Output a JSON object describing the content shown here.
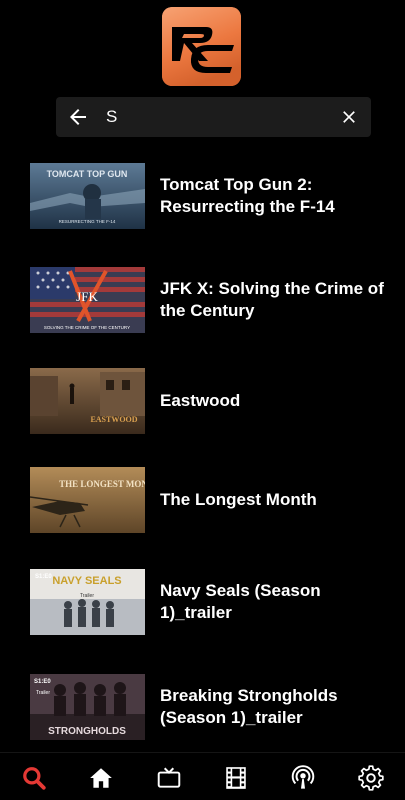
{
  "search": {
    "value": "S",
    "placeholder": ""
  },
  "results": [
    {
      "title": "Tomcat Top Gun 2: Resurrecting the F-14",
      "thumb_text": "TOMCAT TOP GUN",
      "thumb_sub": "RESURRECTING THE F-14"
    },
    {
      "title": "JFK X: Solving the Crime of the Century",
      "thumb_text": "JFK",
      "thumb_sub": "SOLVING THE CRIME OF THE CENTURY"
    },
    {
      "title": "Eastwood",
      "thumb_text": "EASTWOOD"
    },
    {
      "title": "The Longest Month",
      "thumb_text": "THE LONGEST MONTH"
    },
    {
      "title": "Navy Seals (Season 1)_trailer",
      "thumb_text": "NAVY SEALS",
      "thumb_badge": "S1:E0",
      "thumb_sub": "Trailer"
    },
    {
      "title": "Breaking Strongholds (Season 1)_trailer",
      "thumb_text": "STRONGHOLDS",
      "thumb_badge": "S1:E0",
      "thumb_sub": "Trailer"
    }
  ],
  "nav": {
    "active": "search",
    "active_color": "#e53935",
    "items": [
      "search-icon",
      "home-icon",
      "tv-icon",
      "film-icon",
      "podcast-icon",
      "gear-icon"
    ]
  },
  "brand": {
    "accent": "#ec7840"
  }
}
